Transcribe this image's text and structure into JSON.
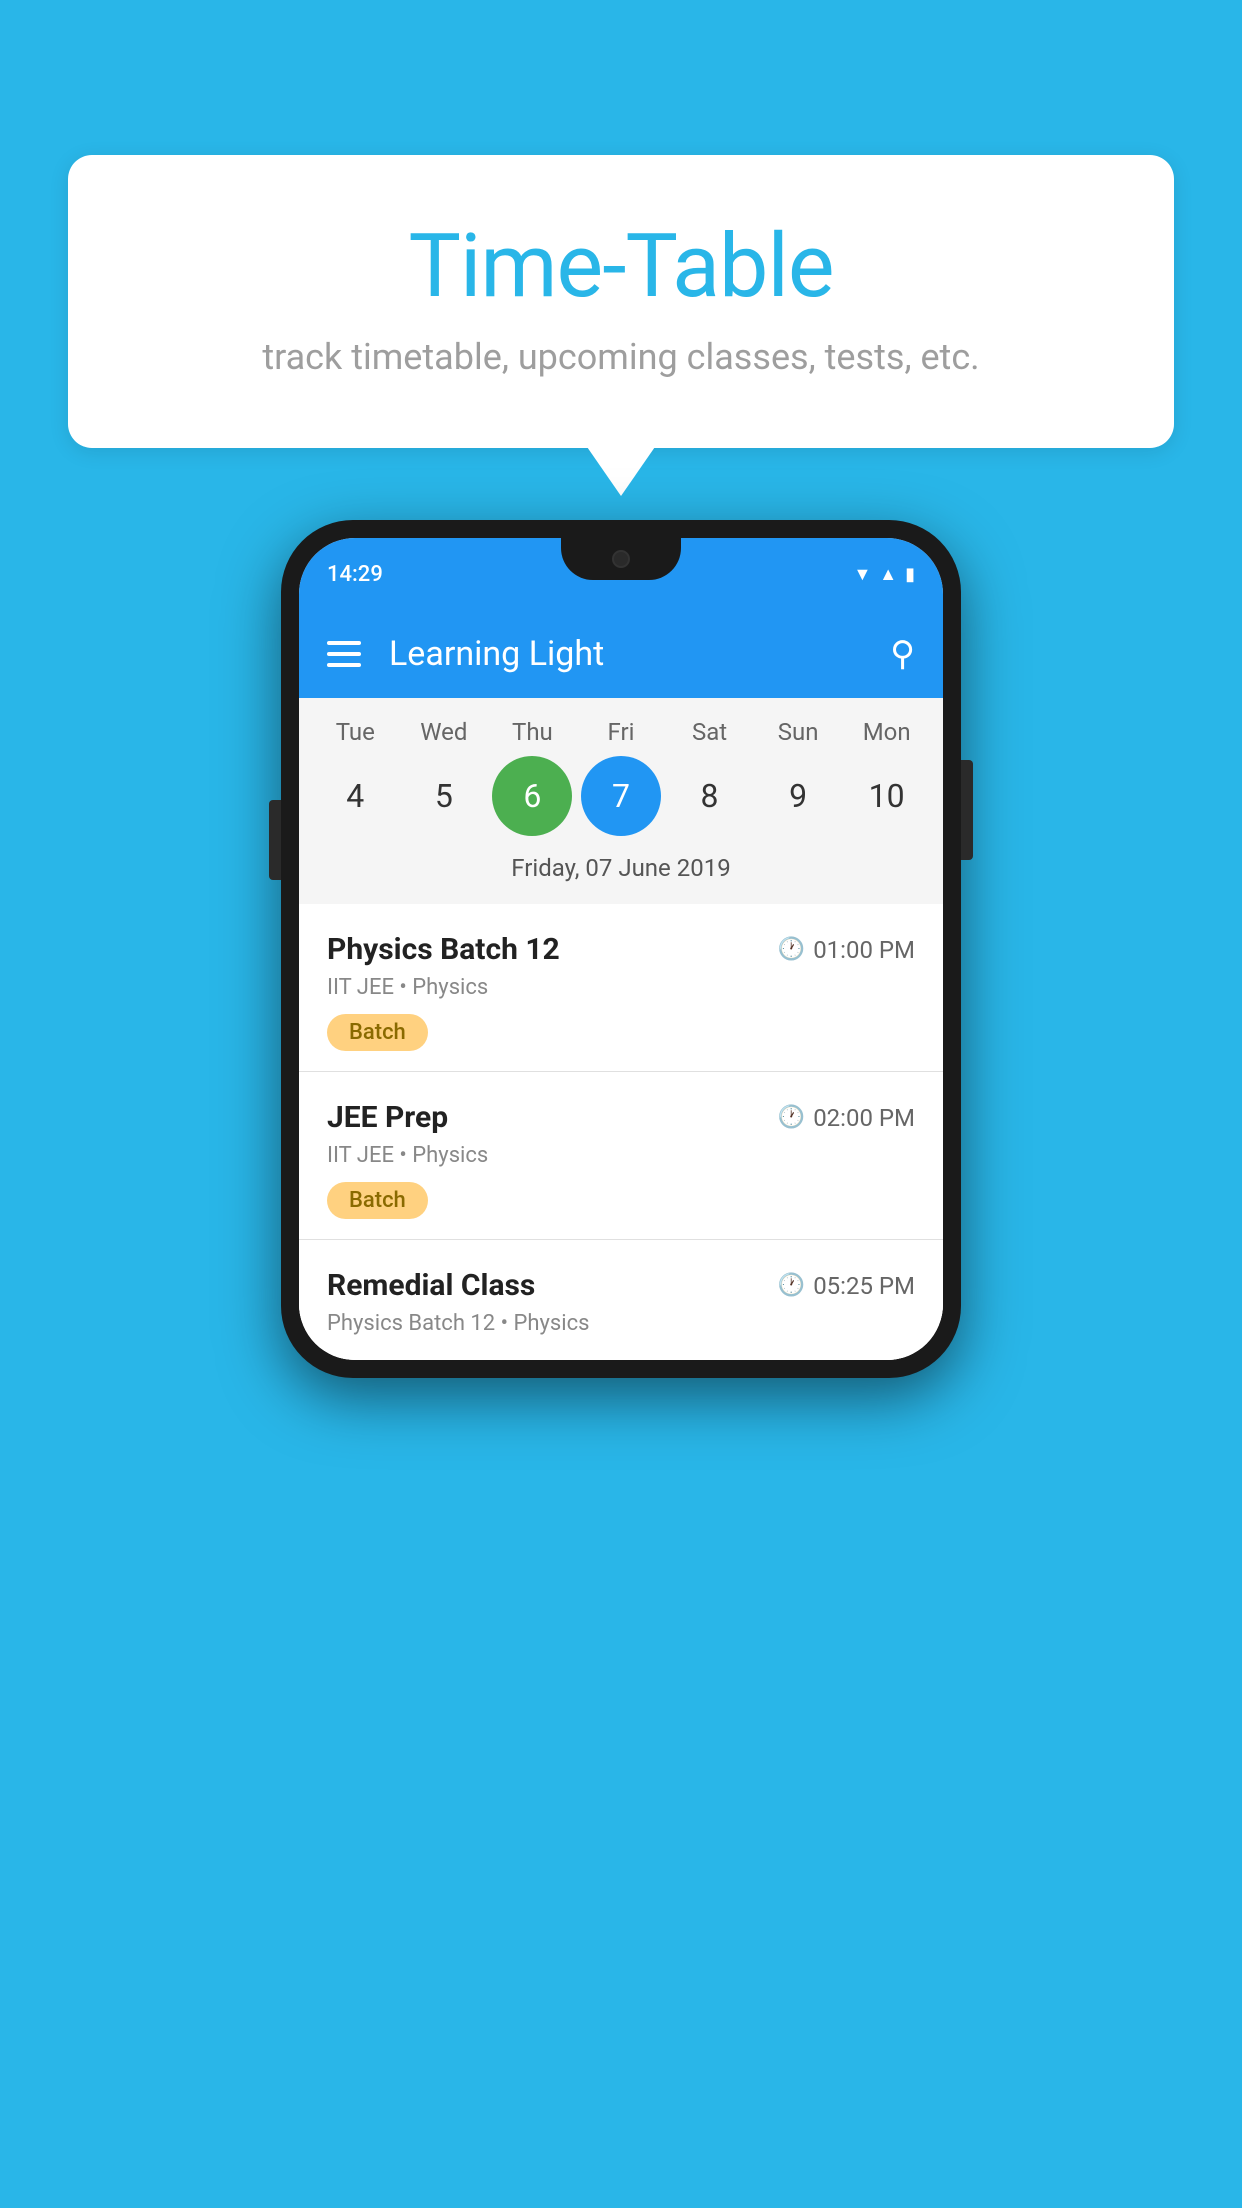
{
  "background_color": "#29b6e8",
  "speech_bubble": {
    "title": "Time-Table",
    "subtitle": "track timetable, upcoming classes, tests, etc."
  },
  "phone": {
    "status_bar": {
      "time": "14:29"
    },
    "app_header": {
      "title": "Learning Light"
    },
    "calendar": {
      "days": [
        {
          "short": "Tue",
          "num": "4"
        },
        {
          "short": "Wed",
          "num": "5"
        },
        {
          "short": "Thu",
          "num": "6",
          "is_today": true
        },
        {
          "short": "Fri",
          "num": "7",
          "is_selected": true
        },
        {
          "short": "Sat",
          "num": "8"
        },
        {
          "short": "Sun",
          "num": "9"
        },
        {
          "short": "Mon",
          "num": "10"
        }
      ],
      "selected_date_label": "Friday, 07 June 2019"
    },
    "schedule_items": [
      {
        "title": "Physics Batch 12",
        "time": "01:00 PM",
        "subtitle": "IIT JEE • Physics",
        "badge": "Batch"
      },
      {
        "title": "JEE Prep",
        "time": "02:00 PM",
        "subtitle": "IIT JEE • Physics",
        "badge": "Batch"
      },
      {
        "title": "Remedial Class",
        "time": "05:25 PM",
        "subtitle": "Physics Batch 12 • Physics",
        "badge": null
      }
    ]
  }
}
